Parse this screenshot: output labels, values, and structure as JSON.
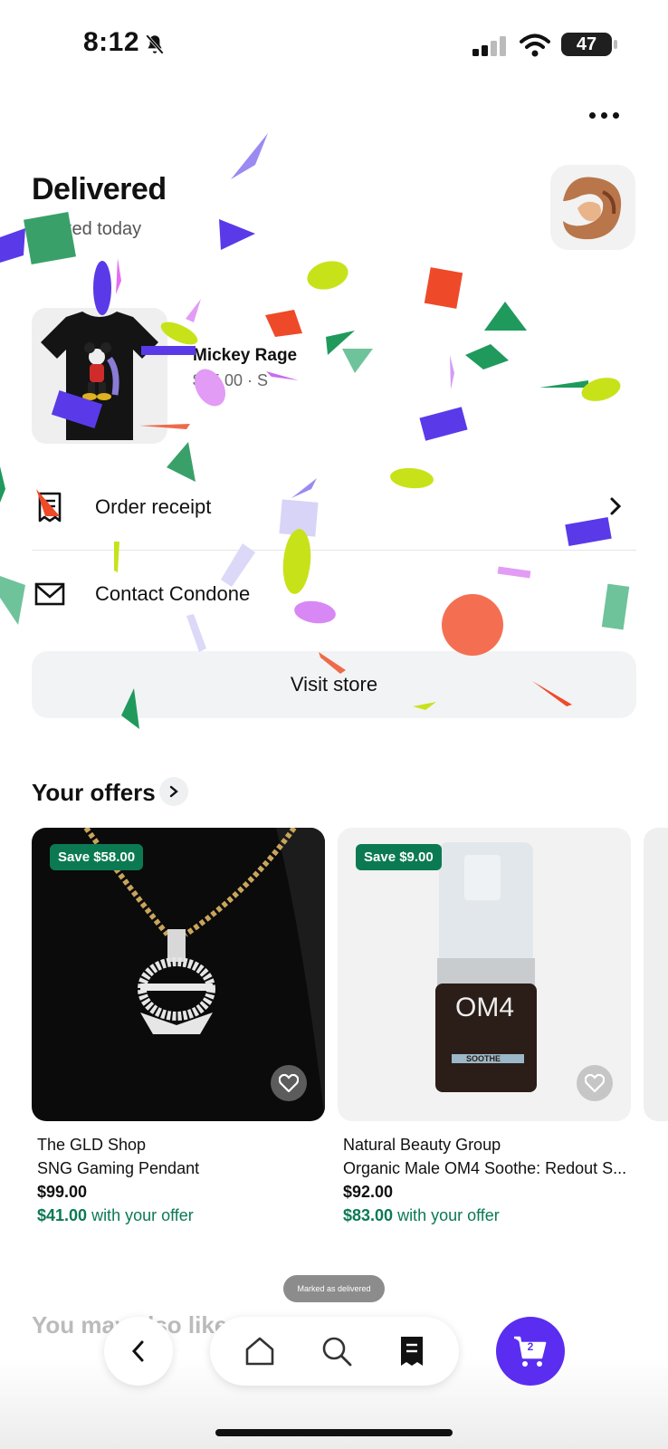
{
  "status_bar": {
    "time": "8:12",
    "battery": "47"
  },
  "order": {
    "status_title": "Delivered",
    "status_sub": "Marked today",
    "product_name": "Mickey Rage",
    "product_meta": "$45.00 · S"
  },
  "actions": {
    "receipt_label": "Order receipt",
    "contact_label": "Contact Condone",
    "visit_store_label": "Visit store"
  },
  "offers": {
    "title": "Your offers",
    "cards": [
      {
        "badge": "Save $58.00",
        "shop": "The GLD Shop",
        "title": "SNG Gaming Pendant",
        "price": "$99.00",
        "offer_price": "$41.00",
        "offer_suffix": " with your offer"
      },
      {
        "badge": "Save $9.00",
        "shop": "Natural Beauty Group",
        "title": "Organic Male OM4 Soothe: Redout S...",
        "price": "$92.00",
        "offer_price": "$83.00",
        "offer_suffix": " with your offer"
      }
    ],
    "product_label_om4": "OM4",
    "product_label_soothe": "SOOTHE"
  },
  "toast": "Marked as delivered",
  "also_like_title": "You may also like",
  "cart_count": "2",
  "colors": {
    "accent": "#5a2df0",
    "offer_green": "#0b7a52"
  }
}
